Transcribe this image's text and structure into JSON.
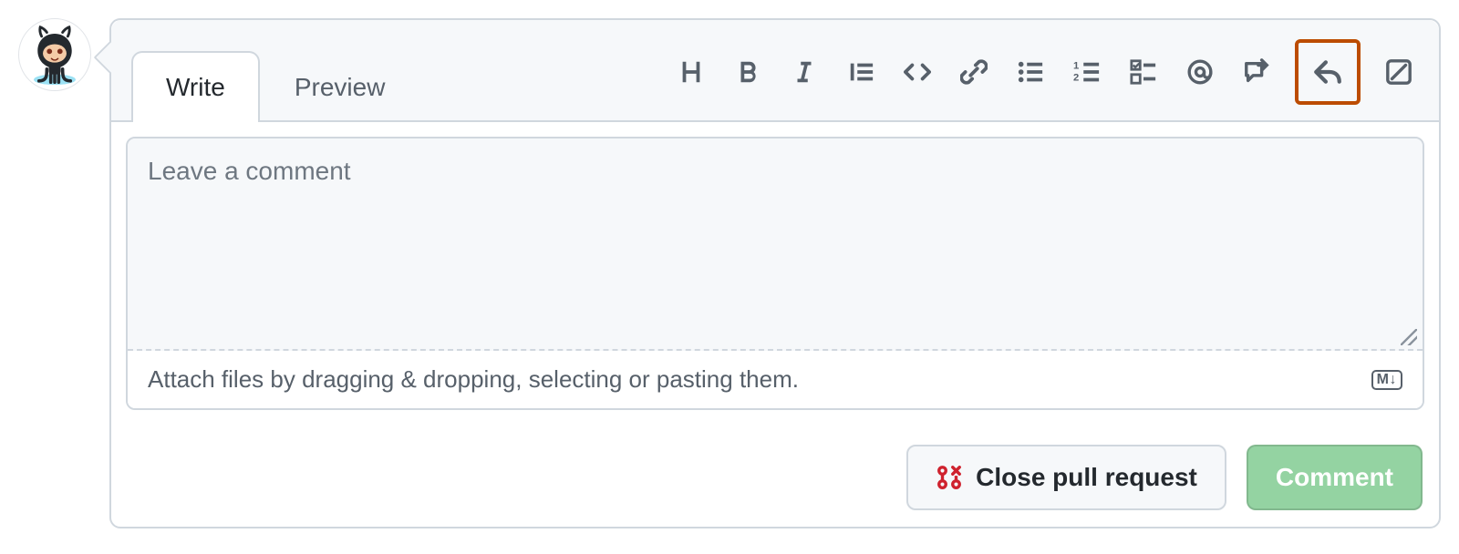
{
  "tabs": {
    "write": "Write",
    "preview": "Preview"
  },
  "toolbar": {
    "heading": "heading-icon",
    "bold": "bold-icon",
    "italic": "italic-icon",
    "quote": "quote-icon",
    "code": "code-icon",
    "link": "link-icon",
    "ul": "bulleted-list-icon",
    "ol": "numbered-list-icon",
    "task": "task-list-icon",
    "mention": "mention-icon",
    "reference": "cross-reference-icon",
    "reply": "reply-icon",
    "suggest": "suggestion-icon"
  },
  "editor": {
    "placeholder": "Leave a comment",
    "attach_hint": "Attach files by dragging & dropping, selecting or pasting them.",
    "markdown_badge": "M↓"
  },
  "actions": {
    "close_label": "Close pull request",
    "comment_label": "Comment"
  }
}
